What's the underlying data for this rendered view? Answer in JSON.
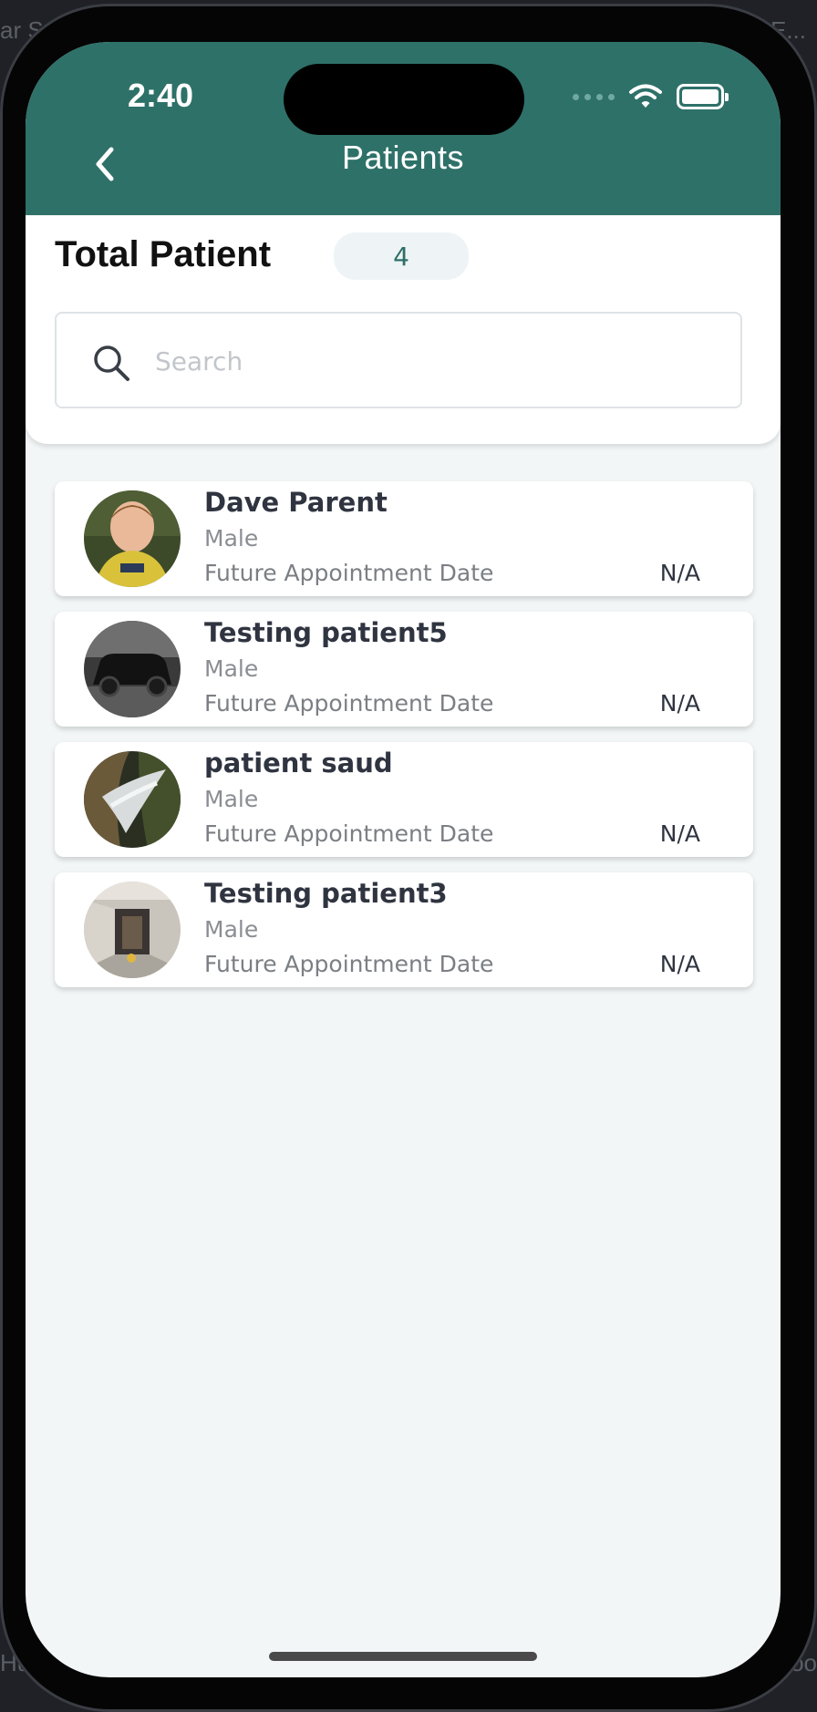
{
  "background": {
    "top_left": "ar Sc",
    "top_right": "h E...",
    "bottom_left": "Hub,",
    "bottom_right": "ge coo"
  },
  "status_bar": {
    "time": "2:40"
  },
  "header": {
    "title": "Patients",
    "back_icon": "chevron-left-icon",
    "color": "#2e7169"
  },
  "summary": {
    "total_label": "Total Patient",
    "total_count": "4"
  },
  "search": {
    "placeholder": "Search",
    "value": ""
  },
  "patients": [
    {
      "name": "Dave Parent",
      "gender": "Male",
      "appointment_label": "Future Appointment Date",
      "appointment_value": "N/A"
    },
    {
      "name": "Testing patient5",
      "gender": "Male",
      "appointment_label": "Future Appointment Date",
      "appointment_value": "N/A"
    },
    {
      "name": "patient saud",
      "gender": "Male",
      "appointment_label": "Future Appointment Date",
      "appointment_value": "N/A"
    },
    {
      "name": "Testing patient3",
      "gender": "Male",
      "appointment_label": "Future Appointment Date",
      "appointment_value": "N/A"
    }
  ]
}
